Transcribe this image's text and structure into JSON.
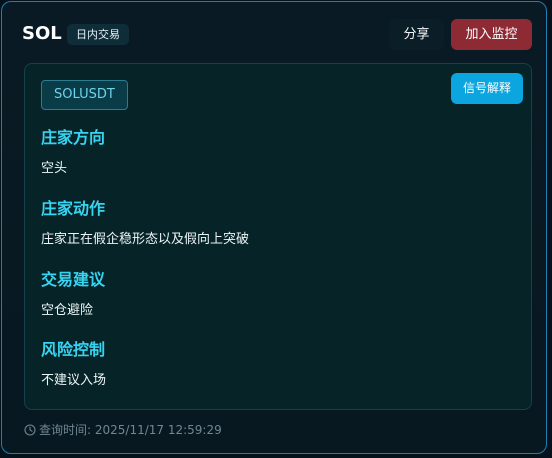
{
  "header": {
    "symbol": "SOL",
    "tag": "日内交易",
    "share_label": "分享",
    "monitor_label": "加入监控"
  },
  "panel": {
    "pair": "SOLUSDT",
    "explain_label": "信号解释",
    "sections": [
      {
        "title": "庄家方向",
        "text": "空头"
      },
      {
        "title": "庄家动作",
        "text": "庄家正在假企稳形态以及假向上突破"
      },
      {
        "title": "交易建议",
        "text": "空仓避险"
      },
      {
        "title": "风险控制",
        "text": "不建议入场"
      }
    ]
  },
  "footer": {
    "query_time": "查询时间: 2025/11/17 12:59:29",
    "icon": "clock-icon"
  },
  "colors": {
    "accent": "#37d4f2",
    "monitor_button": "#8e2a34",
    "explain_button": "#0ba5e0",
    "border": "#1f7fb0"
  }
}
